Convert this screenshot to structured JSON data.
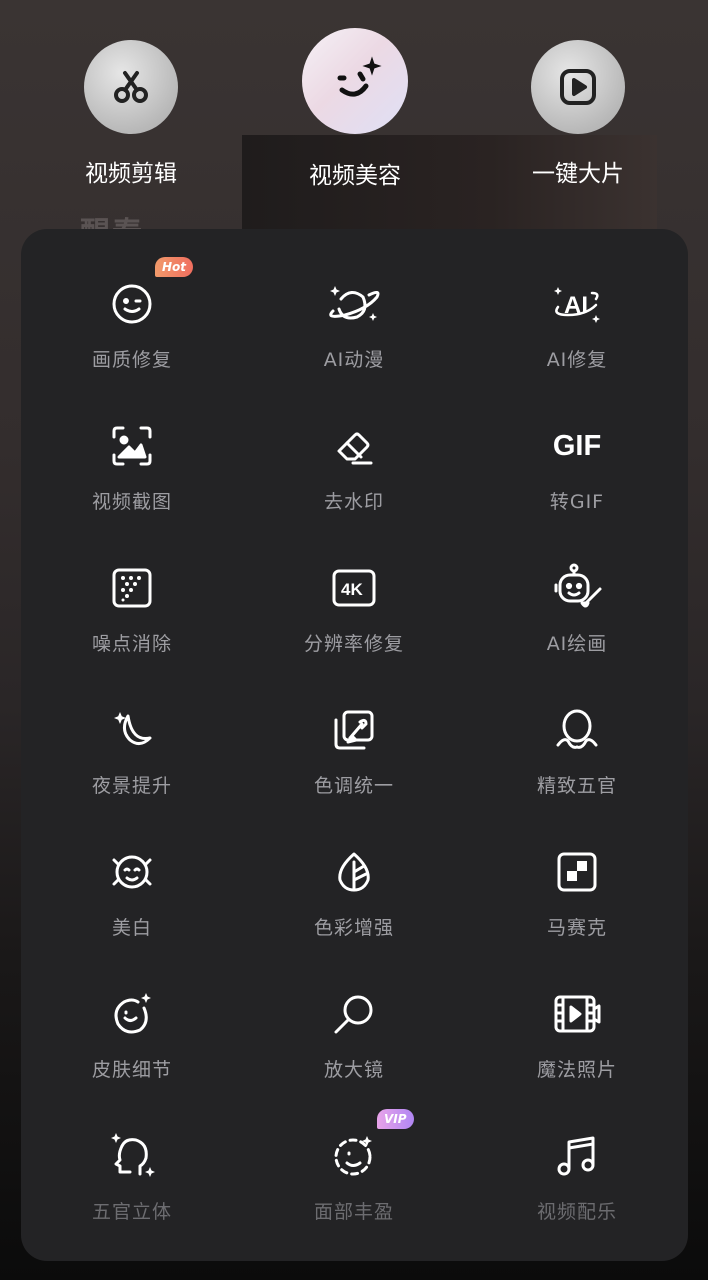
{
  "top_tabs": [
    {
      "label": "视频剪辑",
      "icon": "scissors-icon"
    },
    {
      "label": "视频美容",
      "icon": "wink-face-sparkle-icon",
      "active": true
    },
    {
      "label": "一键大片",
      "icon": "play-square-icon"
    }
  ],
  "background": {
    "text": "醒春"
  },
  "features": [
    {
      "label": "画质修复",
      "icon": "wink-face-icon",
      "badge": "Hot"
    },
    {
      "label": "AI动漫",
      "icon": "planet-sparkle-icon"
    },
    {
      "label": "AI修复",
      "icon": "ai-ring-icon"
    },
    {
      "label": "视频截图",
      "icon": "screenshot-frame-icon"
    },
    {
      "label": "去水印",
      "icon": "eraser-icon"
    },
    {
      "label": "转GIF",
      "icon": "gif-icon",
      "icon_text": "GIF"
    },
    {
      "label": "噪点消除",
      "icon": "dots-square-icon"
    },
    {
      "label": "分辨率修复",
      "icon": "4k-icon",
      "icon_text": "4K"
    },
    {
      "label": "AI绘画",
      "icon": "robot-brush-icon"
    },
    {
      "label": "夜景提升",
      "icon": "moon-sparkle-icon"
    },
    {
      "label": "色调统一",
      "icon": "color-layers-icon"
    },
    {
      "label": "精致五官",
      "icon": "face-outline-icon"
    },
    {
      "label": "美白",
      "icon": "glow-face-icon"
    },
    {
      "label": "色彩增强",
      "icon": "leaf-icon"
    },
    {
      "label": "马赛克",
      "icon": "mosaic-icon"
    },
    {
      "label": "皮肤细节",
      "icon": "smile-sparkle-icon"
    },
    {
      "label": "放大镜",
      "icon": "magnifier-icon"
    },
    {
      "label": "魔法照片",
      "icon": "film-play-icon"
    },
    {
      "label": "五官立体",
      "icon": "head-sparkle-icon"
    },
    {
      "label": "面部丰盈",
      "icon": "dashed-face-icon",
      "badge": "VIP"
    },
    {
      "label": "视频配乐",
      "icon": "music-note-icon"
    }
  ],
  "colors": {
    "panel": "#232325",
    "label": "#9d9da2",
    "hot": "#f06e5f",
    "vip": "#b086f3"
  }
}
